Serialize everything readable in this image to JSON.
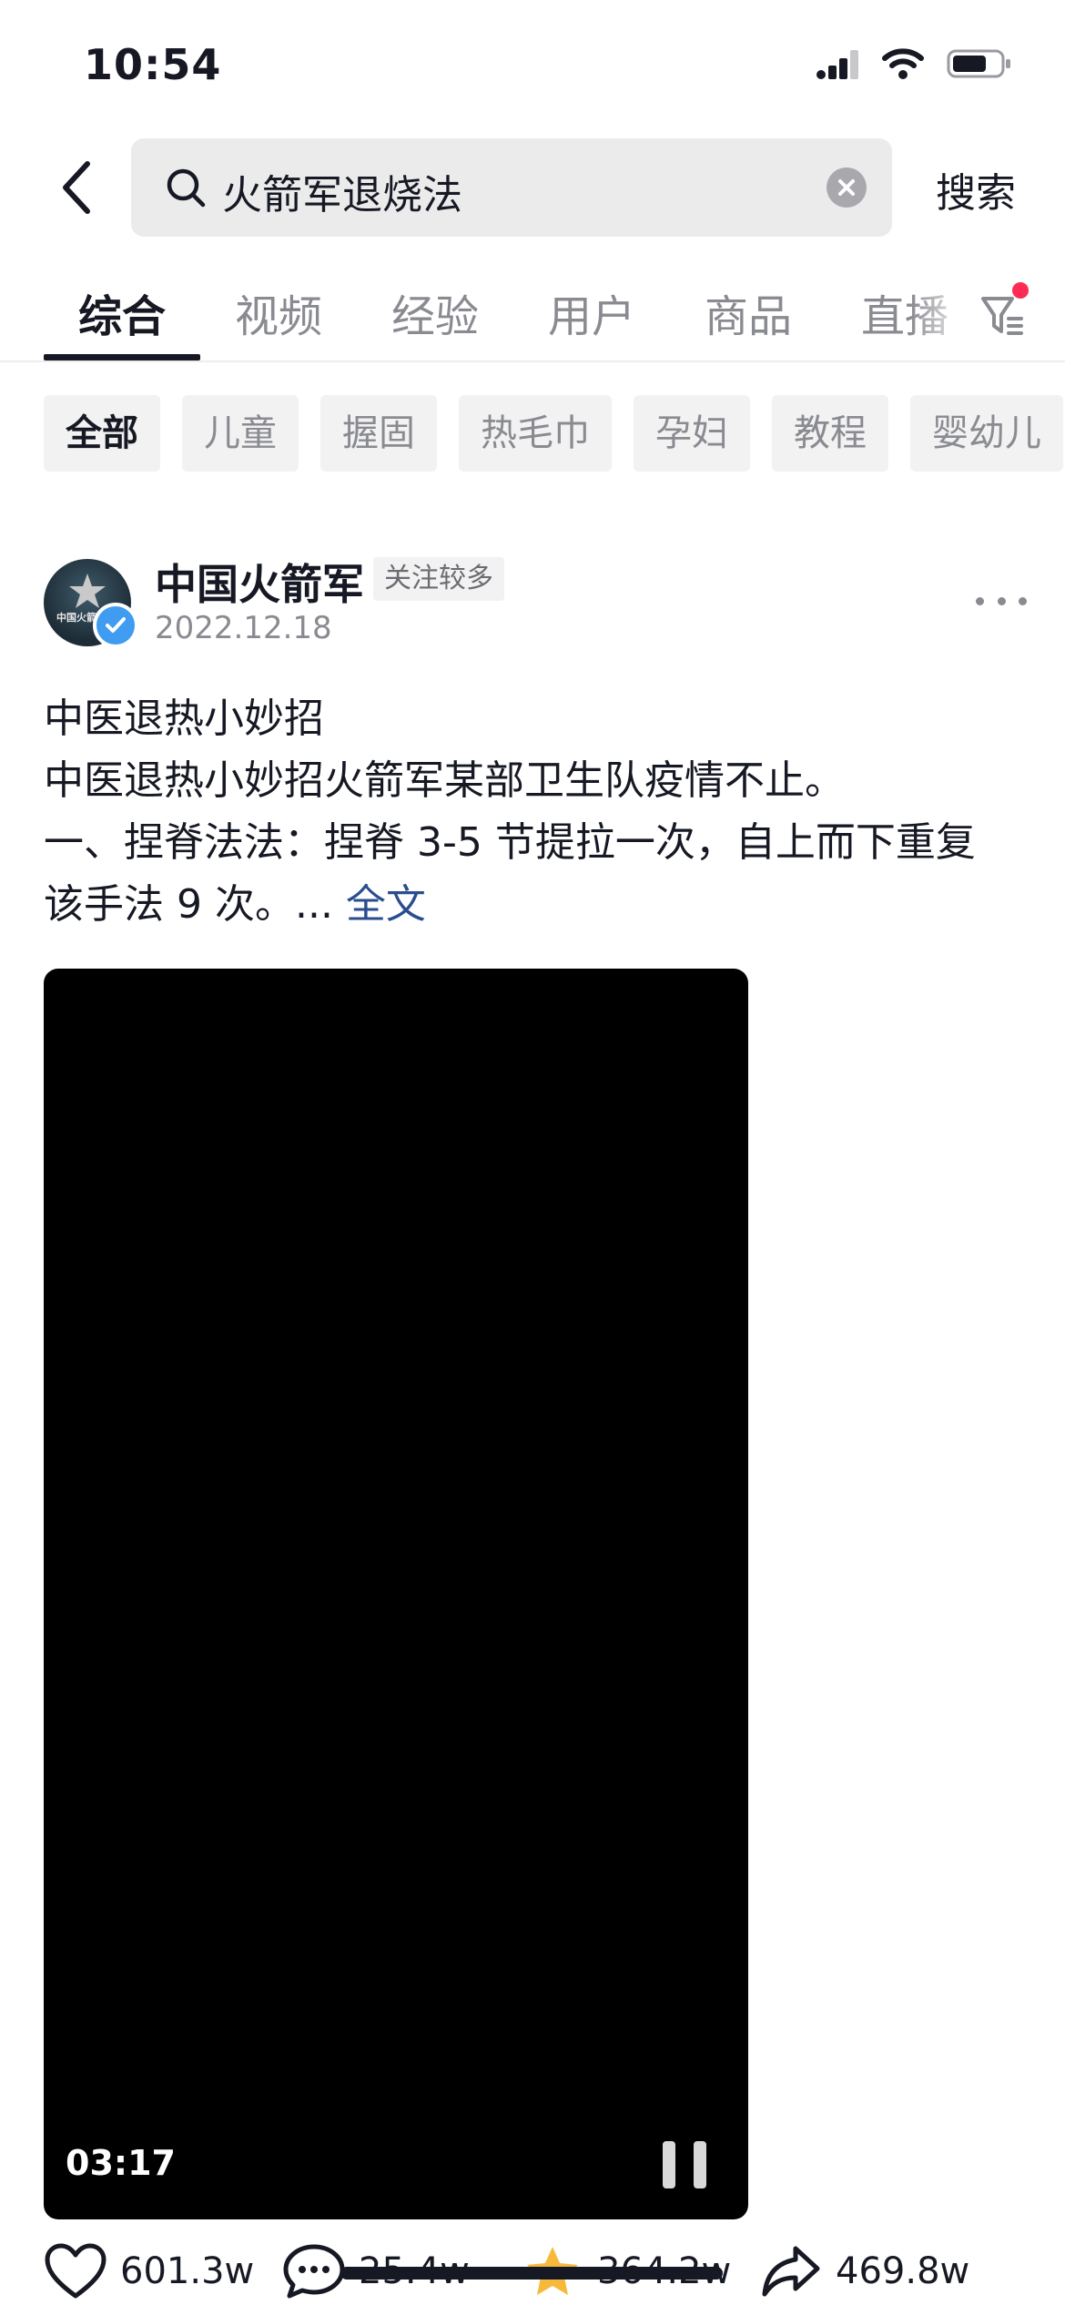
{
  "status_bar": {
    "time": "10:54"
  },
  "search": {
    "query": "火箭军退烧法",
    "action_label": "搜索"
  },
  "tabs": [
    {
      "label": "综合",
      "active": true
    },
    {
      "label": "视频"
    },
    {
      "label": "经验"
    },
    {
      "label": "用户"
    },
    {
      "label": "商品"
    },
    {
      "label": "直播"
    }
  ],
  "chips": [
    "全部",
    "儿童",
    "握固",
    "热毛巾",
    "孕妇",
    "教程",
    "婴幼儿"
  ],
  "post": {
    "author": "中国火箭军",
    "avatar_text": "中国火箭军",
    "badge": "关注较多",
    "date": "2022.12.18",
    "lines": [
      "中医退热小妙招",
      "中医退热小妙招火箭军某部卫生队疫情不止。",
      "一、捏脊法法：捏脊 3-5 节提拉一次，自上而下重复",
      "该手法 9 次。... "
    ],
    "more_link": "全文",
    "video": {
      "duration": "03:17"
    },
    "stats": {
      "likes": "601.3w",
      "comments": "25.4w",
      "favorites": "364.2w",
      "shares": "469.8w"
    }
  },
  "colors": {
    "accent_red": "#fe2c55",
    "verified_blue": "#3f9cf0",
    "link_blue": "#2a4d8f"
  }
}
